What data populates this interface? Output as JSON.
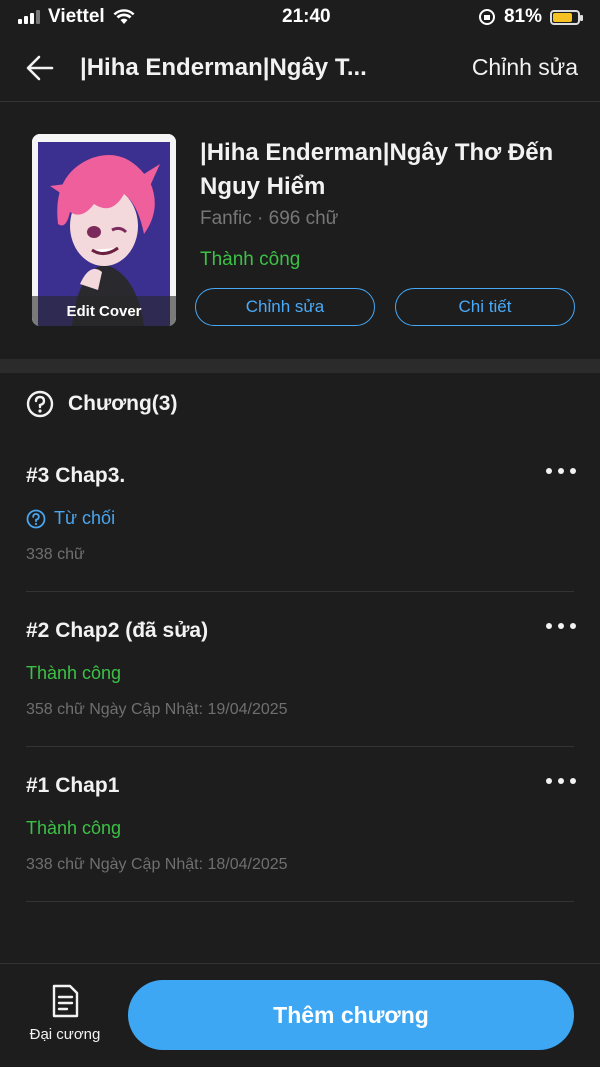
{
  "status_bar": {
    "carrier": "Viettel",
    "time": "21:40",
    "battery": "81%",
    "battery_level": 0.81
  },
  "header": {
    "title": "|Hiha Enderman|Ngây T...",
    "edit_label": "Chỉnh sửa"
  },
  "story": {
    "cover_label": "Edit Cover",
    "title": "|Hiha Enderman|Ngây Thơ Đến Nguy Hiểm",
    "meta": "Fanfic · 696 chữ",
    "status": "Thành công",
    "edit_button": "Chỉnh sửa",
    "detail_button": "Chi tiết"
  },
  "chapters": {
    "heading": "Chương(3)",
    "items": [
      {
        "title": "#3 Chap3.",
        "status": "Từ chối",
        "meta": "338 chữ"
      },
      {
        "title": "#2 Chap2 (đã sửa)",
        "status": "Thành công",
        "meta": "358 chữ Ngày Cập Nhật: 19/04/2025"
      },
      {
        "title": "#1 Chap1",
        "status": "Thành công",
        "meta": "338 chữ Ngày Cập Nhật: 18/04/2025"
      }
    ]
  },
  "bottom": {
    "outline_label": "Đại cương",
    "add_chapter": "Thêm chương"
  },
  "colors": {
    "background": "#1d1d1d",
    "accent": "#3ea7f3",
    "success": "#3cc146",
    "rejected": "#4aa5ee"
  }
}
